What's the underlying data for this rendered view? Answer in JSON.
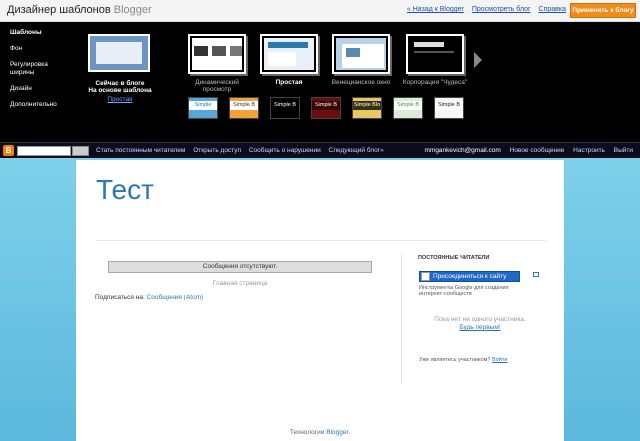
{
  "designer": {
    "title": "Дизайнер шаблонов",
    "brand": "Blogger",
    "links": [
      "« Назад к Blogger",
      "Просмотреть блог",
      "Справка"
    ],
    "apply_button": "Применить к блогу",
    "nav": [
      "Шаблоны",
      "Фон",
      "Регулировка ширины",
      "Дизайн",
      "Дополнительно"
    ],
    "current": {
      "title": "Сейчас в блоге",
      "subtitle": "На основе шаблона",
      "link": "Простая"
    },
    "themes": [
      {
        "label": "Динамический просмотр",
        "color": "#ffffff"
      },
      {
        "label": "Простая",
        "color": "#e9f0f7"
      },
      {
        "label": "Венецианское окно",
        "color": "#ffffff"
      },
      {
        "label": "Корпорация \"Чудеса\"",
        "color": "#000000"
      }
    ],
    "variants": [
      {
        "label": "Simple",
        "bg": "#5aa5d8",
        "hdr": "#ffffff",
        "fg": "#2a7ab0"
      },
      {
        "label": "Simple B",
        "bg": "#f3a23a",
        "hdr": "#ffffff",
        "fg": "#333333"
      },
      {
        "label": "Simple B",
        "bg": "#000000",
        "hdr": "#000000",
        "fg": "#ffffff"
      },
      {
        "label": "Simple B",
        "bg": "#6b0d0d",
        "hdr": "#3a0000",
        "fg": "#ffffff"
      },
      {
        "label": "Simple Blo",
        "bg": "#e7c866",
        "hdr": "#3a2f10",
        "fg": "#ffffff"
      },
      {
        "label": "Simple B",
        "bg": "#dcecd6",
        "hdr": "#ffffff",
        "fg": "#4b8f3b"
      },
      {
        "label": "Simple B",
        "bg": "#f6f6f6",
        "hdr": "#ffffff",
        "fg": "#222222"
      }
    ]
  },
  "navbar": {
    "links": [
      "Стать постоянным читателем",
      "Открыть доступ",
      "Сообщить о нарушении",
      "Следующий блог»"
    ],
    "email": "mmgankevich@gmail.com",
    "right_links": [
      "Новое сообщение",
      "Настроить",
      "Выйти"
    ]
  },
  "blog": {
    "title": "Тест",
    "no_posts": "Сообщения отсутствуют.",
    "home": "Главная страница",
    "subscribe_label": "Подписаться на:",
    "subscribe_link": "Сообщения (Atom)",
    "followers_heading": "ПОСТОЯННЫЕ ЧИТАТЕЛИ",
    "join_button": "Присоединиться к сайту",
    "gfc_text": "Инструменты Google для создания интернет-сообществ",
    "no_members": "Пока нет ни одного участника.",
    "be_first": "Будь первым!",
    "already_label": "Уже являетесь участником?",
    "already_link": "Войти",
    "footer_label": "Технологии",
    "footer_link": "Blogger"
  }
}
